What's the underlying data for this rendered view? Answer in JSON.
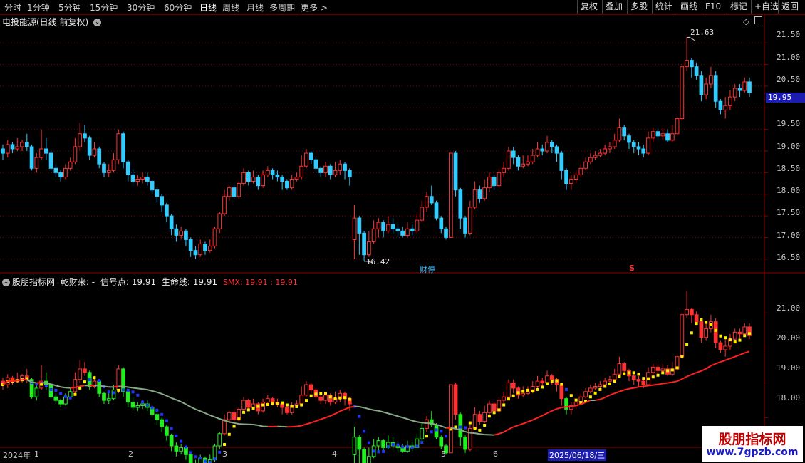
{
  "toolbar": {
    "periods": [
      "分时",
      "1分钟",
      "5分钟",
      "15分钟",
      "30分钟",
      "60分钟",
      "日线",
      "周线",
      "月线",
      "多周期",
      "更多 >"
    ],
    "active_period": "日线",
    "right_tools": [
      "复权",
      "叠加",
      "多股",
      "统计",
      "画线",
      "F10",
      "标记",
      "+自选",
      "返回"
    ]
  },
  "main_panel": {
    "title": "电投能源(日线 前复权)",
    "high_label": "21.63",
    "low_label": "16.42",
    "current_price": "19.95",
    "event_marker_caifu": "财停",
    "event_marker_s": "S",
    "y_axis_ticks": [
      "21.50",
      "21.00",
      "20.50",
      "19.50",
      "19.00",
      "18.50",
      "18.00",
      "17.50",
      "17.00",
      "16.50"
    ]
  },
  "indicator_panel": {
    "name": "股朋指标网",
    "label_qiancailai": "乾财来: -",
    "label_signal": "信号点: 19.91",
    "label_life": "生命线: 19.91",
    "label_smx": "SMX: 19.91 : 19.91",
    "y_axis_ticks": [
      "21.00",
      "20.00",
      "19.00",
      "18.00"
    ]
  },
  "date_axis": {
    "labels": [
      "2024年",
      "1",
      "2",
      "3",
      "4",
      "5",
      "6",
      "2025/06/18/三"
    ]
  },
  "watermark": {
    "line1": "股朋指标网",
    "line2": "www.7gpzb.com"
  },
  "colors": {
    "up": "#ff3333",
    "down": "#33ccff",
    "grid": "#8a0000",
    "yellow": "#ffee00",
    "green": "#22ee22",
    "blue": "#2233ff",
    "gray": "#8aaa8a",
    "red_line": "#ff2222"
  },
  "chart_data": {
    "type": "candlestick",
    "ylim_main": [
      16.2,
      21.9
    ],
    "ylim_indicator": [
      17.2,
      21.8
    ],
    "candles_ohlc": [
      [
        19.05,
        18.95,
        19.15,
        18.8
      ],
      [
        18.95,
        19.15,
        19.25,
        18.85
      ],
      [
        19.15,
        19.05,
        19.2,
        18.95
      ],
      [
        19.05,
        19.1,
        19.3,
        19.0
      ],
      [
        19.1,
        19.2,
        19.25,
        19.0
      ],
      [
        19.2,
        19.1,
        19.4,
        19.0
      ],
      [
        19.1,
        18.6,
        19.15,
        18.55
      ],
      [
        18.6,
        18.85,
        18.95,
        18.5
      ],
      [
        18.85,
        19.05,
        19.5,
        18.8
      ],
      [
        19.05,
        18.95,
        19.3,
        18.8
      ],
      [
        18.95,
        18.6,
        19.0,
        18.55
      ],
      [
        18.6,
        18.5,
        18.7,
        18.4
      ],
      [
        18.5,
        18.4,
        18.55,
        18.3
      ],
      [
        18.4,
        18.6,
        18.7,
        18.35
      ],
      [
        18.6,
        18.75,
        18.85,
        18.55
      ],
      [
        18.75,
        19.1,
        19.3,
        18.7
      ],
      [
        19.1,
        19.4,
        19.65,
        19.0
      ],
      [
        19.4,
        19.3,
        19.6,
        19.2
      ],
      [
        19.3,
        18.9,
        19.35,
        18.8
      ],
      [
        18.9,
        19.05,
        19.2,
        18.85
      ],
      [
        19.05,
        18.7,
        19.1,
        18.6
      ],
      [
        18.7,
        18.5,
        18.75,
        18.4
      ],
      [
        18.5,
        18.55,
        18.7,
        18.4
      ],
      [
        18.55,
        18.8,
        18.95,
        18.5
      ],
      [
        18.8,
        19.4,
        19.5,
        18.7
      ],
      [
        19.4,
        18.75,
        19.45,
        18.6
      ],
      [
        18.75,
        18.45,
        18.8,
        18.3
      ],
      [
        18.45,
        18.3,
        18.6,
        18.2
      ],
      [
        18.3,
        18.35,
        18.45,
        18.2
      ],
      [
        18.35,
        18.4,
        18.5,
        18.25
      ],
      [
        18.4,
        18.3,
        18.5,
        18.2
      ],
      [
        18.3,
        18.1,
        18.35,
        18.0
      ],
      [
        18.1,
        17.95,
        18.15,
        17.8
      ],
      [
        17.95,
        17.75,
        18.0,
        17.6
      ],
      [
        17.75,
        17.5,
        17.8,
        17.35
      ],
      [
        17.5,
        17.2,
        17.55,
        17.05
      ],
      [
        17.2,
        17.05,
        17.3,
        16.9
      ],
      [
        17.05,
        17.15,
        17.25,
        16.95
      ],
      [
        17.15,
        16.95,
        17.2,
        16.8
      ],
      [
        16.95,
        16.7,
        17.0,
        16.55
      ],
      [
        16.7,
        16.6,
        16.8,
        16.5
      ],
      [
        16.6,
        16.85,
        16.95,
        16.55
      ],
      [
        16.85,
        16.7,
        16.9,
        16.6
      ],
      [
        16.7,
        16.8,
        16.95,
        16.65
      ],
      [
        16.8,
        17.2,
        17.25,
        16.75
      ],
      [
        17.2,
        17.55,
        17.6,
        17.1
      ],
      [
        17.55,
        17.95,
        18.1,
        17.5
      ],
      [
        17.95,
        18.15,
        18.2,
        17.85
      ],
      [
        18.15,
        17.95,
        18.25,
        17.9
      ],
      [
        17.95,
        18.25,
        18.3,
        17.9
      ],
      [
        18.25,
        18.5,
        18.6,
        18.2
      ],
      [
        18.5,
        18.3,
        18.55,
        18.2
      ],
      [
        18.3,
        18.4,
        18.55,
        18.25
      ],
      [
        18.4,
        18.2,
        18.45,
        18.1
      ],
      [
        18.2,
        18.45,
        18.55,
        18.15
      ],
      [
        18.45,
        18.55,
        18.65,
        18.4
      ],
      [
        18.55,
        18.45,
        18.6,
        18.35
      ],
      [
        18.45,
        18.4,
        18.55,
        18.3
      ],
      [
        18.4,
        18.3,
        18.45,
        18.1
      ],
      [
        18.3,
        18.15,
        18.35,
        18.1
      ],
      [
        18.15,
        18.35,
        18.45,
        18.1
      ],
      [
        18.35,
        18.4,
        18.5,
        18.3
      ],
      [
        18.4,
        18.65,
        18.9,
        18.35
      ],
      [
        18.65,
        18.95,
        19.05,
        18.6
      ],
      [
        18.95,
        18.8,
        19.0,
        18.7
      ],
      [
        18.8,
        18.6,
        18.85,
        18.55
      ],
      [
        18.6,
        18.5,
        18.65,
        18.4
      ],
      [
        18.5,
        18.65,
        18.75,
        18.4
      ],
      [
        18.65,
        18.45,
        18.7,
        18.35
      ],
      [
        18.45,
        18.55,
        18.75,
        18.4
      ],
      [
        18.55,
        18.7,
        18.8,
        18.45
      ],
      [
        18.7,
        18.55,
        18.75,
        18.35
      ],
      [
        18.55,
        18.4,
        18.6,
        18.2
      ],
      [
        16.95,
        17.45,
        17.75,
        16.5
      ],
      [
        17.45,
        17.1,
        17.5,
        16.6
      ],
      [
        17.1,
        16.6,
        17.15,
        16.45
      ],
      [
        16.6,
        16.9,
        17.15,
        16.55
      ],
      [
        16.9,
        17.2,
        17.4,
        16.85
      ],
      [
        17.2,
        17.35,
        17.45,
        17.0
      ],
      [
        17.35,
        17.15,
        17.4,
        17.0
      ],
      [
        17.15,
        17.3,
        17.5,
        17.1
      ],
      [
        17.3,
        17.2,
        17.45,
        17.1
      ],
      [
        17.2,
        17.15,
        17.3,
        17.0
      ],
      [
        17.15,
        17.05,
        17.25,
        17.0
      ],
      [
        17.05,
        17.2,
        17.35,
        17.0
      ],
      [
        17.2,
        17.15,
        17.3,
        17.05
      ],
      [
        17.15,
        17.4,
        17.55,
        17.1
      ],
      [
        17.4,
        17.7,
        17.85,
        17.35
      ],
      [
        17.7,
        17.95,
        18.05,
        17.6
      ],
      [
        17.95,
        17.8,
        18.2,
        17.75
      ],
      [
        17.8,
        17.45,
        17.85,
        17.4
      ],
      [
        17.45,
        17.2,
        17.5,
        17.1
      ],
      [
        17.2,
        17.0,
        17.25,
        16.95
      ],
      [
        17.0,
        18.95,
        18.95,
        17.0
      ],
      [
        18.95,
        18.1,
        19.0,
        17.95
      ],
      [
        18.1,
        17.45,
        18.15,
        17.2
      ],
      [
        17.45,
        17.1,
        17.5,
        17.0
      ],
      [
        17.1,
        17.7,
        17.85,
        17.05
      ],
      [
        17.7,
        18.1,
        18.3,
        17.65
      ],
      [
        18.1,
        17.9,
        18.2,
        17.8
      ],
      [
        17.9,
        18.15,
        18.35,
        17.85
      ],
      [
        18.15,
        18.4,
        18.5,
        18.05
      ],
      [
        18.4,
        18.2,
        18.45,
        18.1
      ],
      [
        18.2,
        18.5,
        18.6,
        18.15
      ],
      [
        18.5,
        18.6,
        18.75,
        18.4
      ],
      [
        18.6,
        19.0,
        19.1,
        18.55
      ],
      [
        19.0,
        18.85,
        19.1,
        18.7
      ],
      [
        18.85,
        18.65,
        18.9,
        18.55
      ],
      [
        18.65,
        18.7,
        18.9,
        18.6
      ],
      [
        18.7,
        18.75,
        18.9,
        18.65
      ],
      [
        18.75,
        18.9,
        19.05,
        18.7
      ],
      [
        18.9,
        19.05,
        19.2,
        18.85
      ],
      [
        19.05,
        19.0,
        19.15,
        18.9
      ],
      [
        19.0,
        19.2,
        19.35,
        18.95
      ],
      [
        19.2,
        19.1,
        19.25,
        18.95
      ],
      [
        19.1,
        18.95,
        19.15,
        18.75
      ],
      [
        18.95,
        18.55,
        19.0,
        18.35
      ],
      [
        18.55,
        18.25,
        18.6,
        18.1
      ],
      [
        18.25,
        18.35,
        18.45,
        18.1
      ],
      [
        18.35,
        18.45,
        18.55,
        18.25
      ],
      [
        18.45,
        18.6,
        18.7,
        18.4
      ],
      [
        18.6,
        18.75,
        18.85,
        18.55
      ],
      [
        18.75,
        18.85,
        18.95,
        18.7
      ],
      [
        18.85,
        18.9,
        19.0,
        18.8
      ],
      [
        18.9,
        18.95,
        19.05,
        18.85
      ],
      [
        18.95,
        19.05,
        19.15,
        18.9
      ],
      [
        19.05,
        19.1,
        19.2,
        18.95
      ],
      [
        19.1,
        19.25,
        19.4,
        19.05
      ],
      [
        19.25,
        19.55,
        19.75,
        19.2
      ],
      [
        19.55,
        19.35,
        19.6,
        19.25
      ],
      [
        19.35,
        19.2,
        19.4,
        19.05
      ],
      [
        19.2,
        19.1,
        19.25,
        18.95
      ],
      [
        19.1,
        19.05,
        19.2,
        18.9
      ],
      [
        19.05,
        18.95,
        19.15,
        18.85
      ],
      [
        18.95,
        19.3,
        19.45,
        18.9
      ],
      [
        19.3,
        19.45,
        19.55,
        19.2
      ],
      [
        19.45,
        19.35,
        19.55,
        19.25
      ],
      [
        19.35,
        19.4,
        19.55,
        19.25
      ],
      [
        19.4,
        19.25,
        19.5,
        19.2
      ],
      [
        19.25,
        19.4,
        19.6,
        19.2
      ],
      [
        19.4,
        19.75,
        19.8,
        19.35
      ],
      [
        19.75,
        20.95,
        21.0,
        19.7
      ],
      [
        20.95,
        21.1,
        21.63,
        20.85
      ],
      [
        21.1,
        20.95,
        21.15,
        20.7
      ],
      [
        20.95,
        20.75,
        21.05,
        20.65
      ],
      [
        20.75,
        20.3,
        20.85,
        20.15
      ],
      [
        20.3,
        20.55,
        20.7,
        20.2
      ],
      [
        20.55,
        20.75,
        20.95,
        20.45
      ],
      [
        20.75,
        20.15,
        20.85,
        20.0
      ],
      [
        20.15,
        19.95,
        20.2,
        19.85
      ],
      [
        19.95,
        20.05,
        20.25,
        19.75
      ],
      [
        20.05,
        20.25,
        20.4,
        19.95
      ],
      [
        20.25,
        20.45,
        20.55,
        20.15
      ],
      [
        20.45,
        20.4,
        20.55,
        20.25
      ],
      [
        20.4,
        20.6,
        20.7,
        20.35
      ],
      [
        20.6,
        20.35,
        20.7,
        20.25
      ]
    ],
    "signal_line_blue_segments": [
      [
        0,
        0,
        19.25
      ],
      [
        50,
        0,
        18.42
      ]
    ],
    "life_line": [
      18.45,
      18.4,
      18.3,
      18.1,
      17.95,
      17.75,
      17.7,
      17.7,
      17.85,
      17.95,
      18.05,
      18.4,
      18.7,
      19.05,
      19.3,
      19.6,
      19.9
    ],
    "y_label": "",
    "x_label": ""
  }
}
